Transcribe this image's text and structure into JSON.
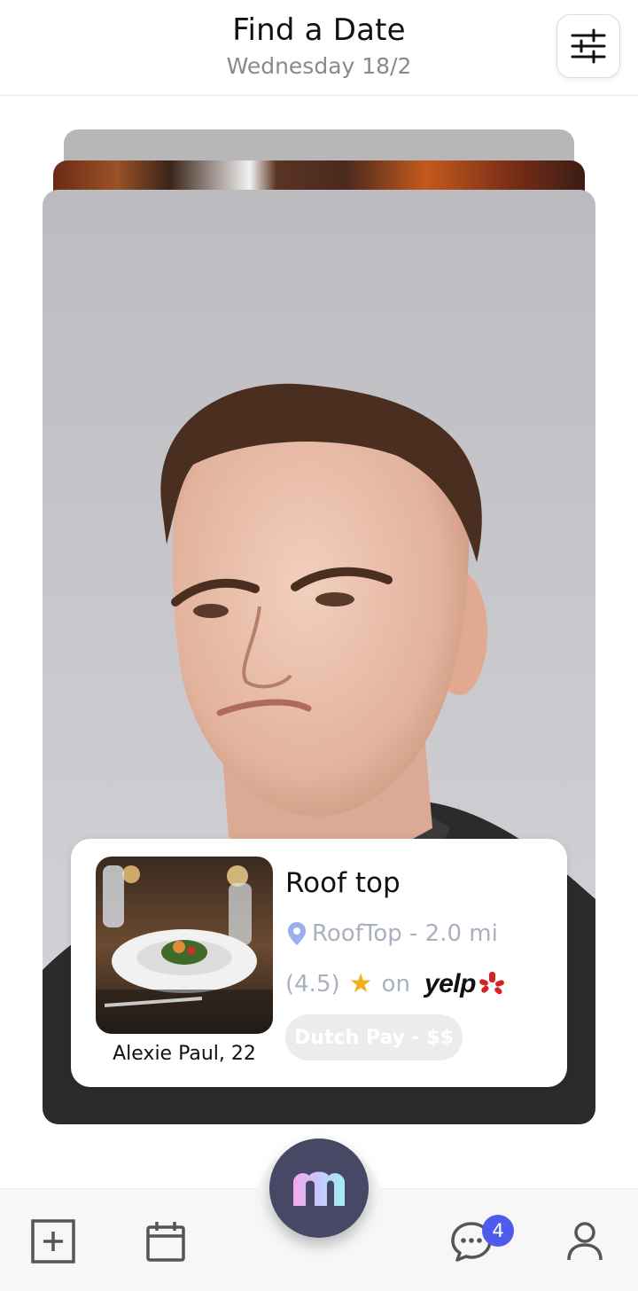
{
  "header": {
    "title": "Find a Date",
    "subtitle": "Wednesday 18/2",
    "filter_icon": "sliders-icon"
  },
  "card": {
    "person_name": "Alexie Paul, 22",
    "place_title": "Roof top",
    "location": "RoofTop - 2.0 mi",
    "rating": "(4.5)",
    "rating_on": "on",
    "rating_source": "yelp",
    "payment": "Dutch Pay - $$"
  },
  "nav": {
    "items": [
      "add-post-icon",
      "calendar-icon",
      "app-logo",
      "chat-icon",
      "profile-icon"
    ],
    "chat_badge": "4",
    "logo_letter": "m"
  },
  "colors": {
    "accent": "#4f5bea",
    "fab": "#464866",
    "star": "#f2b01e",
    "yelp_red": "#d32323",
    "muted_text": "#a9b0bf"
  }
}
